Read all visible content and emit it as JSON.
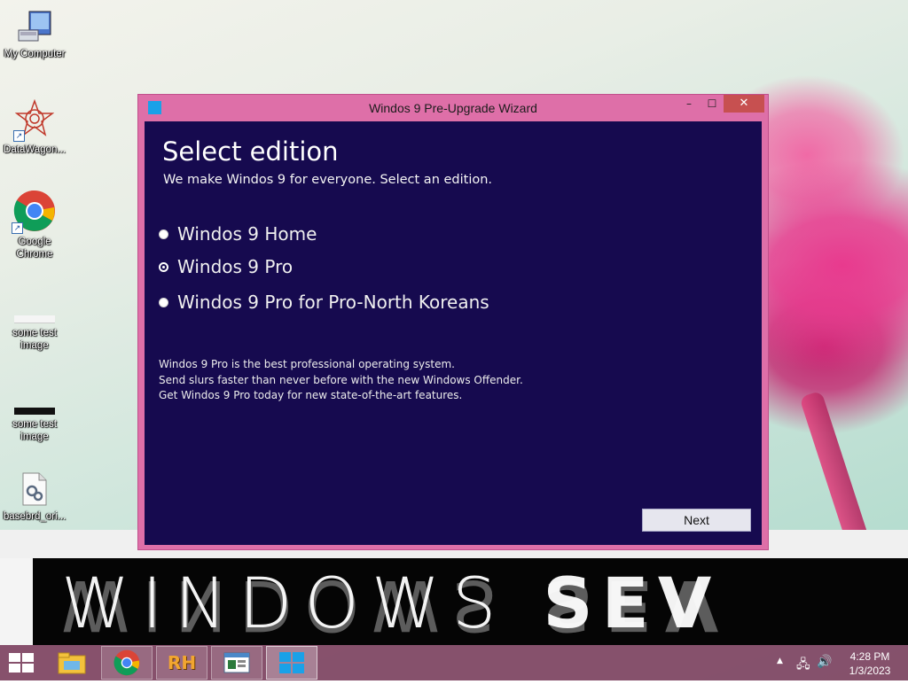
{
  "desktop": {
    "icons": [
      {
        "label": "My Computer",
        "icon": "computer-icon"
      },
      {
        "label": "DataWagon...",
        "icon": "datawagon-icon"
      },
      {
        "label": "Google Chrome",
        "icon": "chrome-icon"
      },
      {
        "label": "some test image",
        "icon": "image-file-icon"
      },
      {
        "label": "some test image",
        "icon": "image-file-icon"
      },
      {
        "label": "basebrd_ori...",
        "icon": "settings-file-icon"
      }
    ]
  },
  "banner": {
    "text_light": "WINDOWS ",
    "text_bold": "SEV"
  },
  "window": {
    "title": "Windos 9 Pre-Upgrade Wizard",
    "minimize": "–",
    "maximize": "☐",
    "close": "✕",
    "heading": "Select edition",
    "subheading": "We make Windos 9 for everyone. Select an edition.",
    "options": [
      {
        "label": "Windos 9 Home",
        "selected": false
      },
      {
        "label": "Windos 9 Pro",
        "selected": true
      },
      {
        "label": "Windos 9 Pro for Pro-North Koreans",
        "selected": false
      }
    ],
    "description": [
      "Windos 9 Pro is the best professional operating system.",
      "Send slurs faster than never before with the new Windows Offender.",
      "Get Windos 9 Pro today for new state-of-the-art features."
    ],
    "next_label": "Next"
  },
  "taskbar": {
    "items": [
      {
        "name": "file-explorer-icon"
      },
      {
        "name": "chrome-icon"
      },
      {
        "name": "rh-icon",
        "text": "RH"
      },
      {
        "name": "window-app-icon"
      },
      {
        "name": "windows-logo-icon"
      }
    ],
    "tray_up_arrow": "▲",
    "tray_network": "🖧",
    "tray_volume": "🔊",
    "time": "4:28 PM",
    "date": "1/3/2023"
  },
  "colors": {
    "window_frame": "#de6fa8",
    "content_bg": "#160a4f",
    "close_button": "#c75050",
    "taskbar": "#82466a"
  }
}
